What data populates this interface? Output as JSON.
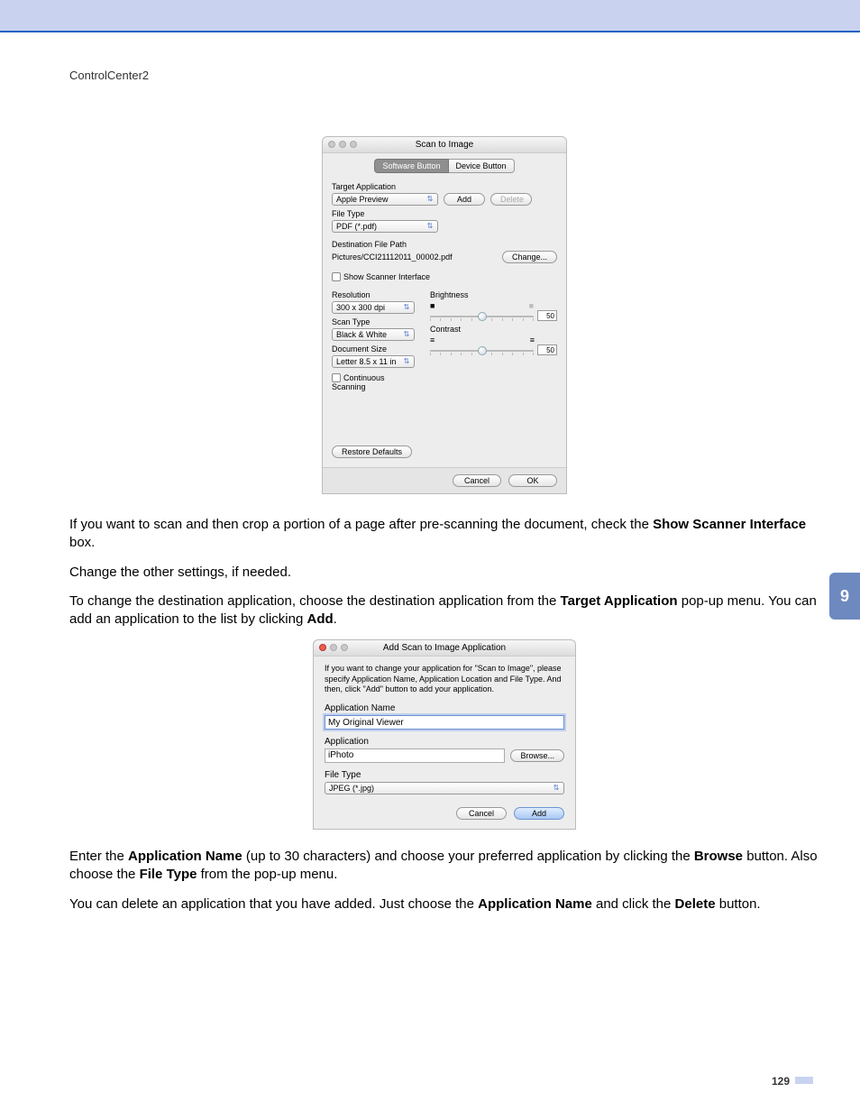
{
  "header": "ControlCenter2",
  "chapter": "9",
  "pagenum": "129",
  "scanwin": {
    "title": "Scan to Image",
    "tabs": {
      "software": "Software Button",
      "device": "Device Button"
    },
    "target_app_label": "Target Application",
    "target_app_value": "Apple Preview",
    "add_btn": "Add",
    "delete_btn": "Delete",
    "file_type_label": "File Type",
    "file_type_value": "PDF (*.pdf)",
    "dest_label": "Destination File Path",
    "dest_value": "Pictures/CCI21112011_00002.pdf",
    "change_btn": "Change...",
    "show_scanner": "Show Scanner Interface",
    "resolution_label": "Resolution",
    "resolution_value": "300 x 300 dpi",
    "scan_type_label": "Scan Type",
    "scan_type_value": "Black & White",
    "doc_size_label": "Document Size",
    "doc_size_value": "Letter 8.5 x 11 in",
    "continuous": "Continuous Scanning",
    "brightness_label": "Brightness",
    "brightness_value": "50",
    "contrast_label": "Contrast",
    "contrast_value": "50",
    "restore": "Restore Defaults",
    "cancel": "Cancel",
    "ok": "OK"
  },
  "para1a": "If you want to scan and then crop a portion of a page after pre-scanning the document, check the ",
  "para1b": "Show Scanner Interface",
  "para1c": " box.",
  "para2": "Change the other settings, if needed.",
  "para3a": "To change the destination application, choose the destination application from the ",
  "para3b": "Target Application",
  "para3c": " pop-up menu. You can add an application to the list by clicking ",
  "para3d": "Add",
  "para3e": ".",
  "addwin": {
    "title": "Add Scan to Image Application",
    "intro": "If you want to change your application for \"Scan to Image\", please specify Application Name, Application Location and File Type. And then, click \"Add\" button to add your application.",
    "app_name_label": "Application Name",
    "app_name_value": "My Original Viewer",
    "app_label": "Application",
    "app_value": "iPhoto",
    "browse": "Browse...",
    "file_type_label": "File Type",
    "file_type_value": "JPEG (*.jpg)",
    "cancel": "Cancel",
    "add": "Add"
  },
  "para4a": "Enter the ",
  "para4b": "Application Name",
  "para4c": " (up to 30 characters) and choose your preferred application by clicking the ",
  "para4d": "Browse",
  "para4e": " button. Also choose the ",
  "para4f": "File Type",
  "para4g": " from the pop-up menu.",
  "para5a": "You can delete an application that you have added. Just choose the ",
  "para5b": "Application Name",
  "para5c": " and click the ",
  "para5d": "Delete",
  "para5e": " button."
}
